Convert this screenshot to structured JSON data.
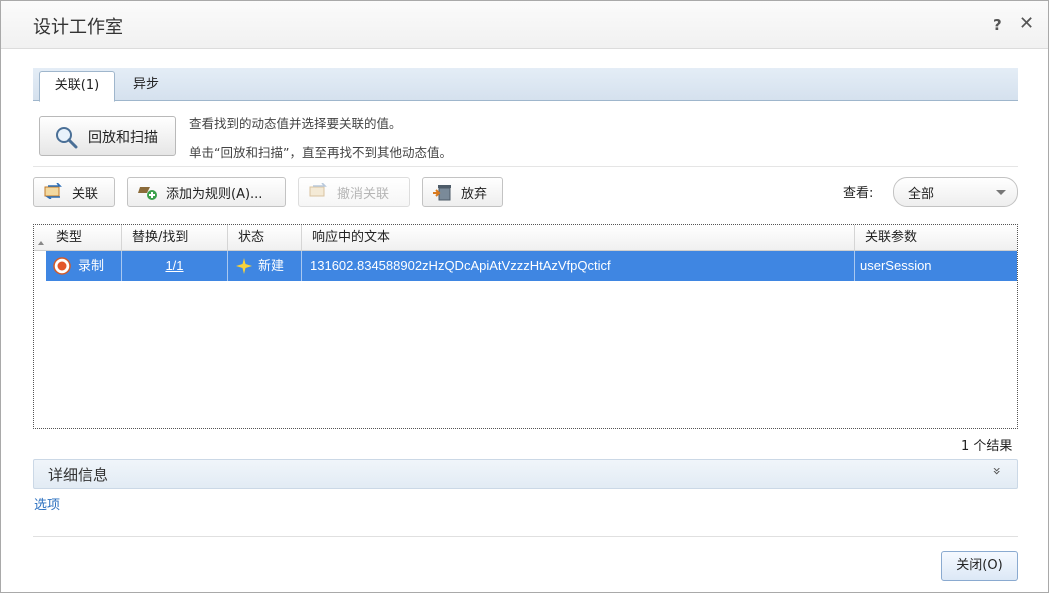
{
  "window": {
    "title": "设计工作室",
    "help_label": "?",
    "close_label": "✕"
  },
  "tabs": [
    {
      "label": "关联(1)",
      "active": true
    },
    {
      "label": "异步",
      "active": false
    }
  ],
  "scan": {
    "button_label": "回放和扫描",
    "hint_line1": "查看找到的动态值并选择要关联的值。",
    "hint_line2": "单击“回放和扫描”，直至再找不到其他动态值。"
  },
  "toolbar": {
    "correlate_label": "关联",
    "add_rule_label": "添加为规则(A)...",
    "undo_label": "撤消关联",
    "discard_label": "放弃",
    "view_label": "查看:",
    "view_value": "全部"
  },
  "grid": {
    "columns": [
      "类型",
      "替换/找到",
      "状态",
      "响应中的文本",
      "关联参数"
    ],
    "rows": [
      {
        "type": "录制",
        "replace_found": "1/1",
        "status": "新建",
        "text": "131602.834588902zHzQDcApiAtVzzzHtAzVfpQcticf",
        "param": "userSession"
      }
    ],
    "result_count": "1 个结果"
  },
  "details": {
    "label": "详细信息",
    "chevron": "»"
  },
  "options_label": "选项",
  "footer": {
    "close_label": "关闭(O)"
  },
  "colors": {
    "selected_row": "#3f86e2",
    "tab_strip": "#d5e1ee",
    "link": "#2a6fbf"
  },
  "icons": [
    "search-icon",
    "correlate-icon",
    "add-rule-icon",
    "undo-icon",
    "trash-icon",
    "record-icon",
    "new-star-icon",
    "chevron-down-icon"
  ]
}
